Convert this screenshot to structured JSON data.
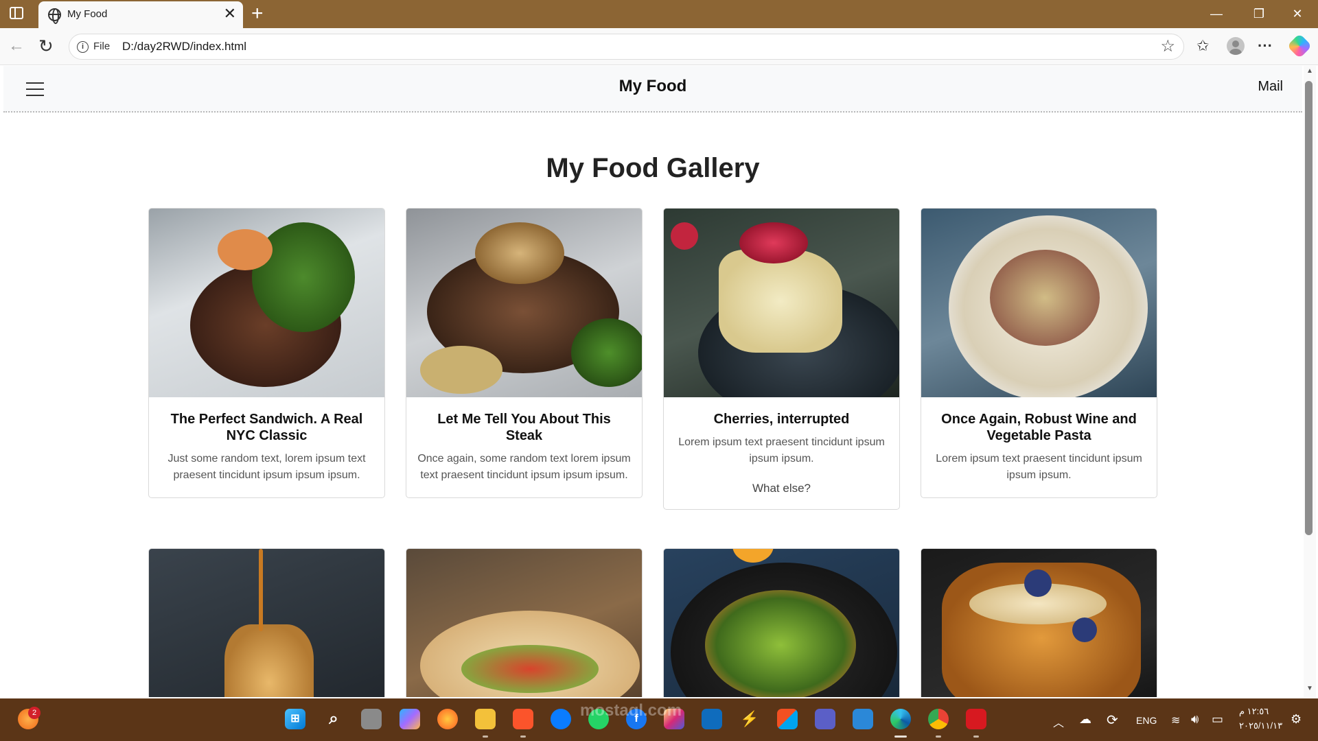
{
  "browser": {
    "tab_title": "My Food",
    "address_prefix": "File",
    "address_url": "D:/day2RWD/index.html"
  },
  "site": {
    "brand": "My Food",
    "mail_link": "Mail",
    "gallery_title": "My Food Gallery"
  },
  "cards": [
    {
      "title": "The Perfect Sandwich. A Real NYC Classic",
      "text": "Just some random text, lorem ipsum text praesent tincidunt ipsum ipsum ipsum.",
      "extra": ""
    },
    {
      "title": "Let Me Tell You About This Steak",
      "text": "Once again, some random text lorem ipsum text praesent tincidunt ipsum ipsum ipsum.",
      "extra": ""
    },
    {
      "title": "Cherries, interrupted",
      "text": "Lorem ipsum text praesent tincidunt ipsum ipsum ipsum.",
      "extra": "What else?"
    },
    {
      "title": "Once Again, Robust Wine and Vegetable Pasta",
      "text": "Lorem ipsum text praesent tincidunt ipsum ipsum ipsum.",
      "extra": ""
    }
  ],
  "taskbar": {
    "notification_count": "2",
    "language": "ENG",
    "time": "١٢:٥٦ م",
    "date": "٢٠٢٥/١١/١٣"
  },
  "watermark": "mostaql.com"
}
